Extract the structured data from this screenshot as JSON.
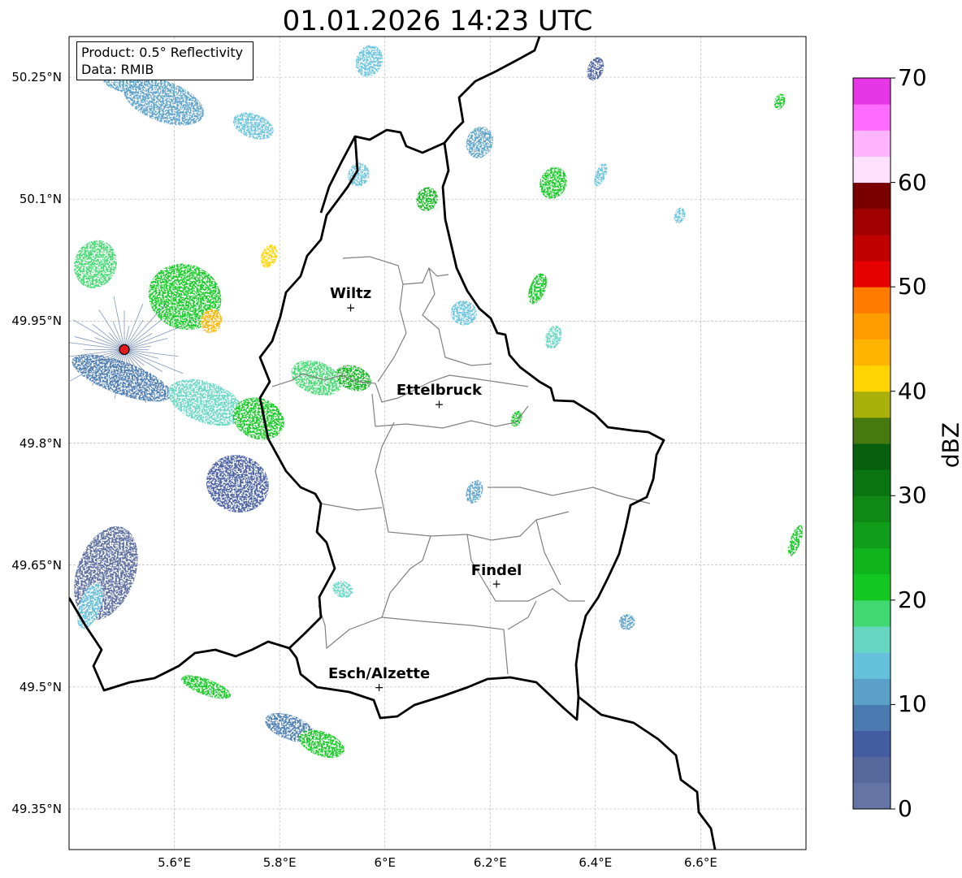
{
  "title": "01.01.2026 14:23 UTC",
  "info": {
    "product": "Product: 0.5° Reflectivity",
    "data_source": "Data: RMIB"
  },
  "map": {
    "lon_range": [
      5.4,
      6.8
    ],
    "lat_range": [
      49.3,
      50.3
    ],
    "lon_ticks": [
      {
        "value": 5.6,
        "label": "5.6°E"
      },
      {
        "value": 5.8,
        "label": "5.8°E"
      },
      {
        "value": 6.0,
        "label": "6°E"
      },
      {
        "value": 6.2,
        "label": "6.2°E"
      },
      {
        "value": 6.4,
        "label": "6.4°E"
      },
      {
        "value": 6.6,
        "label": "6.6°E"
      }
    ],
    "lat_ticks": [
      {
        "value": 50.25,
        "label": "50.25°N"
      },
      {
        "value": 50.1,
        "label": "50.1°N"
      },
      {
        "value": 49.95,
        "label": "49.95°N"
      },
      {
        "value": 49.8,
        "label": "49.8°N"
      },
      {
        "value": 49.65,
        "label": "49.65°N"
      },
      {
        "value": 49.5,
        "label": "49.5°N"
      },
      {
        "value": 49.35,
        "label": "49.35°N"
      }
    ],
    "grid": true,
    "radar_site": {
      "lon": 5.505,
      "lat": 49.915,
      "color": "#e41a1c"
    },
    "cities": [
      {
        "name": "Wiltz",
        "lon": 5.935,
        "lat": 49.967
      },
      {
        "name": "Ettelbruck",
        "lon": 6.103,
        "lat": 49.848
      },
      {
        "name": "Findel",
        "lon": 6.212,
        "lat": 49.627
      },
      {
        "name": "Esch/Alzette",
        "lon": 5.989,
        "lat": 49.5
      }
    ]
  },
  "colorbar": {
    "label": "dBZ",
    "min": 0,
    "max": 70,
    "step": 2.5,
    "ticks": [
      {
        "value": 0,
        "label": "0"
      },
      {
        "value": 10,
        "label": "10"
      },
      {
        "value": 20,
        "label": "20"
      },
      {
        "value": 30,
        "label": "30"
      },
      {
        "value": 40,
        "label": "40"
      },
      {
        "value": 50,
        "label": "50"
      },
      {
        "value": 60,
        "label": "60"
      },
      {
        "value": 70,
        "label": "70"
      }
    ],
    "colors": [
      "#6474a4",
      "#56689c",
      "#445ca0",
      "#4a7ab0",
      "#5aa0c8",
      "#66c2dc",
      "#64d6c2",
      "#40d870",
      "#12c820",
      "#10b41c",
      "#109e1a",
      "#0e8a14",
      "#0a7410",
      "#08600e",
      "#467a0e",
      "#aab00a",
      "#ffd400",
      "#ffb400",
      "#ff9c00",
      "#ff7c00",
      "#e60000",
      "#c00000",
      "#a00000",
      "#7a0000",
      "#ffe0ff",
      "#ffb4ff",
      "#ff6cff",
      "#e636e6"
    ]
  },
  "echoes": [
    {
      "lon": 5.5,
      "lat": 50.25,
      "w": 0.09,
      "h": 0.035,
      "dbz": 12
    },
    {
      "lon": 5.58,
      "lat": 50.22,
      "w": 0.16,
      "h": 0.05,
      "dbz": 10
    },
    {
      "lon": 5.75,
      "lat": 50.19,
      "w": 0.08,
      "h": 0.03,
      "dbz": 14
    },
    {
      "lon": 5.97,
      "lat": 50.27,
      "w": 0.05,
      "h": 0.04,
      "dbz": 13
    },
    {
      "lon": 5.45,
      "lat": 50.02,
      "w": 0.08,
      "h": 0.06,
      "dbz": 18
    },
    {
      "lon": 5.62,
      "lat": 49.98,
      "w": 0.14,
      "h": 0.08,
      "dbz": 20
    },
    {
      "lon": 5.67,
      "lat": 49.95,
      "w": 0.04,
      "h": 0.03,
      "dbz": 44
    },
    {
      "lon": 5.78,
      "lat": 50.03,
      "w": 0.03,
      "h": 0.03,
      "dbz": 42
    },
    {
      "lon": 5.5,
      "lat": 49.88,
      "w": 0.2,
      "h": 0.04,
      "dbz": 8
    },
    {
      "lon": 5.66,
      "lat": 49.85,
      "w": 0.15,
      "h": 0.05,
      "dbz": 16
    },
    {
      "lon": 5.76,
      "lat": 49.83,
      "w": 0.1,
      "h": 0.05,
      "dbz": 22
    },
    {
      "lon": 5.87,
      "lat": 49.88,
      "w": 0.1,
      "h": 0.04,
      "dbz": 18
    },
    {
      "lon": 5.94,
      "lat": 49.88,
      "w": 0.07,
      "h": 0.03,
      "dbz": 24
    },
    {
      "lon": 5.72,
      "lat": 49.75,
      "w": 0.12,
      "h": 0.07,
      "dbz": 5
    },
    {
      "lon": 5.47,
      "lat": 49.64,
      "w": 0.11,
      "h": 0.12,
      "dbz": 4
    },
    {
      "lon": 5.44,
      "lat": 49.6,
      "w": 0.04,
      "h": 0.06,
      "dbz": 13
    },
    {
      "lon": 5.66,
      "lat": 49.5,
      "w": 0.1,
      "h": 0.02,
      "dbz": 20
    },
    {
      "lon": 5.82,
      "lat": 49.45,
      "w": 0.1,
      "h": 0.03,
      "dbz": 8
    },
    {
      "lon": 5.88,
      "lat": 49.43,
      "w": 0.09,
      "h": 0.03,
      "dbz": 22
    },
    {
      "lon": 5.95,
      "lat": 50.13,
      "w": 0.04,
      "h": 0.03,
      "dbz": 14
    },
    {
      "lon": 6.08,
      "lat": 50.1,
      "w": 0.04,
      "h": 0.03,
      "dbz": 24
    },
    {
      "lon": 6.18,
      "lat": 50.17,
      "w": 0.05,
      "h": 0.04,
      "dbz": 12
    },
    {
      "lon": 6.32,
      "lat": 50.12,
      "w": 0.05,
      "h": 0.04,
      "dbz": 22
    },
    {
      "lon": 6.41,
      "lat": 50.13,
      "w": 0.02,
      "h": 0.03,
      "dbz": 14
    },
    {
      "lon": 6.4,
      "lat": 50.26,
      "w": 0.03,
      "h": 0.03,
      "dbz": 6
    },
    {
      "lon": 6.29,
      "lat": 49.99,
      "w": 0.03,
      "h": 0.04,
      "dbz": 20
    },
    {
      "lon": 6.32,
      "lat": 49.93,
      "w": 0.03,
      "h": 0.03,
      "dbz": 16
    },
    {
      "lon": 6.15,
      "lat": 49.96,
      "w": 0.05,
      "h": 0.03,
      "dbz": 14
    },
    {
      "lon": 6.17,
      "lat": 49.74,
      "w": 0.03,
      "h": 0.03,
      "dbz": 12
    },
    {
      "lon": 6.25,
      "lat": 49.83,
      "w": 0.02,
      "h": 0.02,
      "dbz": 22
    },
    {
      "lon": 6.78,
      "lat": 49.68,
      "w": 0.02,
      "h": 0.04,
      "dbz": 20
    },
    {
      "lon": 6.56,
      "lat": 50.08,
      "w": 0.02,
      "h": 0.02,
      "dbz": 14
    },
    {
      "lon": 5.92,
      "lat": 49.62,
      "w": 0.04,
      "h": 0.02,
      "dbz": 16
    },
    {
      "lon": 6.46,
      "lat": 49.58,
      "w": 0.03,
      "h": 0.02,
      "dbz": 10
    },
    {
      "lon": 6.75,
      "lat": 50.22,
      "w": 0.02,
      "h": 0.02,
      "dbz": 20
    }
  ]
}
